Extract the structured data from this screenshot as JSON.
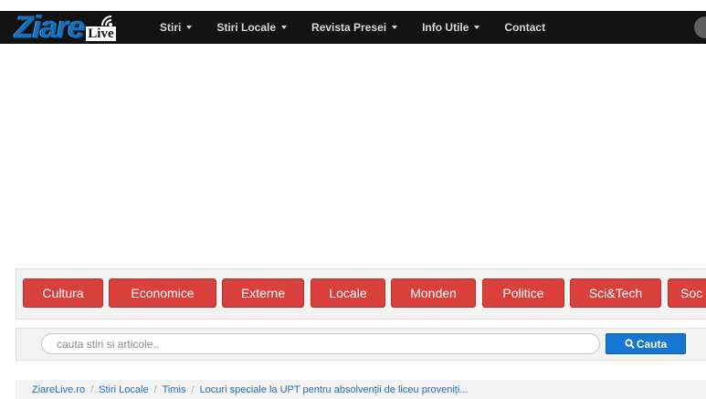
{
  "logo": {
    "primary": "Ziare",
    "secondary": "Live"
  },
  "nav": {
    "items": [
      {
        "label": "Stiri",
        "dropdown": true
      },
      {
        "label": "Stiri Locale",
        "dropdown": true
      },
      {
        "label": "Revista Presei",
        "dropdown": true
      },
      {
        "label": "Info Utile",
        "dropdown": true
      },
      {
        "label": "Contact",
        "dropdown": false
      }
    ]
  },
  "categories": [
    "Cultura",
    "Economice",
    "Externe",
    "Locale",
    "Monden",
    "Politice",
    "Sci&Tech",
    "Soc"
  ],
  "search": {
    "placeholder": "cauta stiri si articole..",
    "button_label": "Cauta"
  },
  "breadcrumb": {
    "items": [
      "ZiareLive.ro",
      "Stiri Locale",
      "Timis"
    ],
    "current": "Locuri speciale la UPT pentru absolvenții de liceu proveniți..."
  },
  "colors": {
    "navbar": "#121212",
    "category_button": "#d9403b",
    "search_button": "#1677d2",
    "link": "#2a6fb0"
  }
}
